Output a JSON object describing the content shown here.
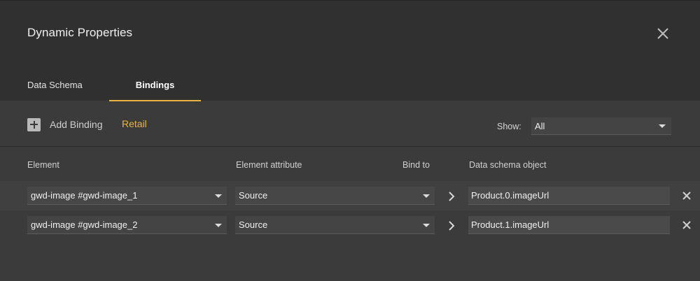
{
  "dialog": {
    "title": "Dynamic Properties",
    "close_icon": "close-icon"
  },
  "tabs": [
    {
      "label": "Data Schema",
      "active": false
    },
    {
      "label": "Bindings",
      "active": true
    }
  ],
  "toolbar": {
    "add_binding_label": "Add Binding",
    "add_icon": "plus-box-icon",
    "retail_label": "Retail",
    "show_label": "Show:",
    "show_value": "All"
  },
  "columns": {
    "element": "Element",
    "attribute": "Element attribute",
    "bind_to": "Bind to",
    "data_object": "Data schema object"
  },
  "rows": [
    {
      "element": "gwd-image #gwd-image_1",
      "attribute": "Source",
      "data_object": "Product.0.imageUrl"
    },
    {
      "element": "gwd-image #gwd-image_2",
      "attribute": "Source",
      "data_object": "Product.1.imageUrl"
    }
  ],
  "colors": {
    "accent": "#e8b63e",
    "header_bg": "#303030",
    "body_bg": "#3b3b3b"
  }
}
